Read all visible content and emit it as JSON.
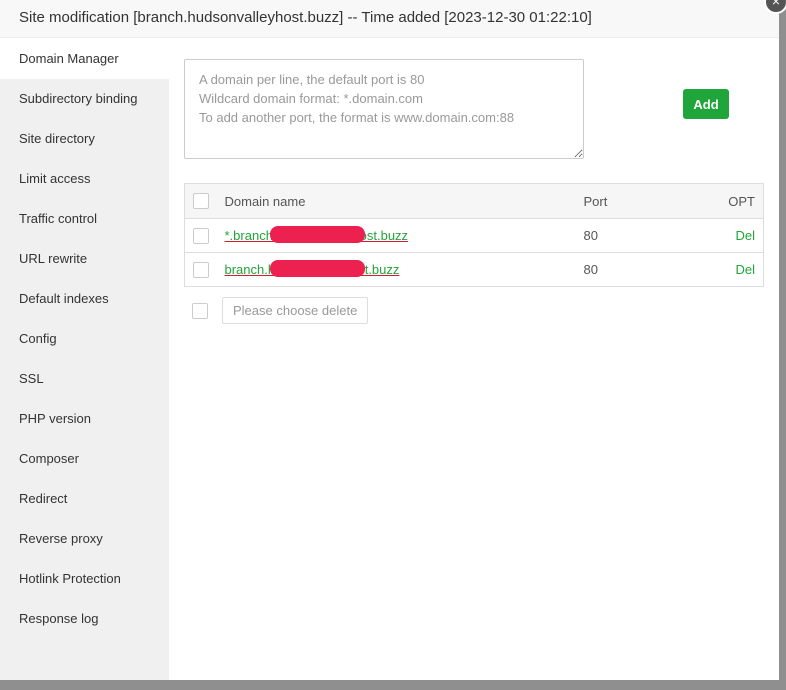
{
  "title": "Site modification [branch.hudsonvalleyhost.buzz] -- Time added [2023-12-30 01:22:10]",
  "sidebar": {
    "active": 0,
    "items": [
      "Domain Manager",
      "Subdirectory binding",
      "Site directory",
      "Limit access",
      "Traffic control",
      "URL rewrite",
      "Default indexes",
      "Config",
      "SSL",
      "PHP version",
      "Composer",
      "Redirect",
      "Reverse proxy",
      "Hotlink Protection",
      "Response log"
    ]
  },
  "form": {
    "placeholder": "A domain per line, the default port is 80\nWildcard domain format: *.domain.com\nTo add another port, the format is www.domain.com:88",
    "add_label": "Add"
  },
  "table": {
    "headers": {
      "domain": "Domain name",
      "port": "Port",
      "opt": "OPT"
    },
    "rows": [
      {
        "domain": "*.branch.hudsonvalleyhost.buzz",
        "port": "80",
        "opt": "Del"
      },
      {
        "domain": "branch.hudsonvalleyhost.buzz",
        "port": "80",
        "opt": "Del"
      }
    ]
  },
  "bulk_delete_label": "Please choose delete",
  "colors": {
    "accent": "#20a53a"
  }
}
